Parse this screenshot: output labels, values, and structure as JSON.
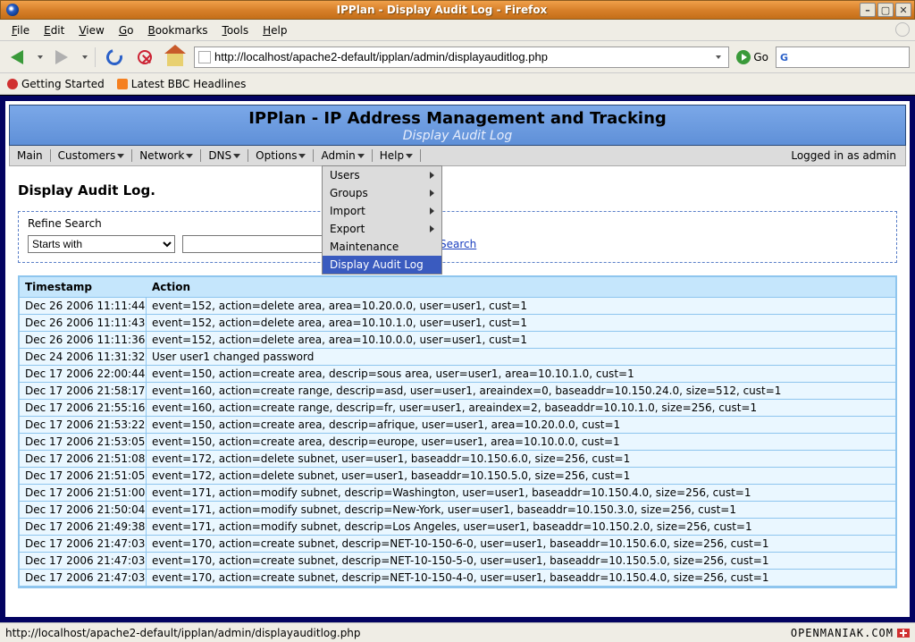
{
  "window": {
    "title": "IPPlan - Display Audit Log - Firefox"
  },
  "menubar": {
    "file": "File",
    "edit": "Edit",
    "view": "View",
    "go": "Go",
    "bookmarks": "Bookmarks",
    "tools": "Tools",
    "help": "Help"
  },
  "toolbar": {
    "url": "http://localhost/apache2-default/ipplan/admin/displayauditlog.php",
    "go_label": "Go"
  },
  "bookmarks": {
    "getting_started": "Getting Started",
    "bbc": "Latest BBC Headlines"
  },
  "app": {
    "title": "IPPlan - IP Address Management and Tracking",
    "subtitle": "Display Audit Log",
    "nav": {
      "main": "Main",
      "customers": "Customers",
      "network": "Network",
      "dns": "DNS",
      "options": "Options",
      "admin": "Admin",
      "help": "Help"
    },
    "login_status": "Logged in as admin",
    "admin_menu": {
      "users": "Users",
      "groups": "Groups",
      "import": "Import",
      "export": "Export",
      "maintenance": "Maintenance",
      "display_audit_log": "Display Audit Log"
    },
    "page_heading": "Display Audit Log.",
    "refine": {
      "legend": "Refine Search",
      "mode": "Starts with",
      "search_label": "Search"
    },
    "table": {
      "col_timestamp": "Timestamp",
      "col_action": "Action",
      "rows": [
        {
          "ts": "Dec 26 2006 11:11:44",
          "action": "event=152, action=delete area, area=10.20.0.0, user=user1, cust=1"
        },
        {
          "ts": "Dec 26 2006 11:11:43",
          "action": "event=152, action=delete area, area=10.10.1.0, user=user1, cust=1"
        },
        {
          "ts": "Dec 26 2006 11:11:36",
          "action": "event=152, action=delete area, area=10.10.0.0, user=user1, cust=1"
        },
        {
          "ts": "Dec 24 2006 11:31:32",
          "action": "User user1 changed password"
        },
        {
          "ts": "Dec 17 2006 22:00:44",
          "action": "event=150, action=create area, descrip=sous area, user=user1, area=10.10.1.0, cust=1"
        },
        {
          "ts": "Dec 17 2006 21:58:17",
          "action": "event=160, action=create range, descrip=asd, user=user1, areaindex=0, baseaddr=10.150.24.0, size=512, cust=1"
        },
        {
          "ts": "Dec 17 2006 21:55:16",
          "action": "event=160, action=create range, descrip=fr, user=user1, areaindex=2, baseaddr=10.10.1.0, size=256, cust=1"
        },
        {
          "ts": "Dec 17 2006 21:53:22",
          "action": "event=150, action=create area, descrip=afrique, user=user1, area=10.20.0.0, cust=1"
        },
        {
          "ts": "Dec 17 2006 21:53:05",
          "action": "event=150, action=create area, descrip=europe, user=user1, area=10.10.0.0, cust=1"
        },
        {
          "ts": "Dec 17 2006 21:51:08",
          "action": "event=172, action=delete subnet, user=user1, baseaddr=10.150.6.0, size=256, cust=1"
        },
        {
          "ts": "Dec 17 2006 21:51:05",
          "action": "event=172, action=delete subnet, user=user1, baseaddr=10.150.5.0, size=256, cust=1"
        },
        {
          "ts": "Dec 17 2006 21:51:00",
          "action": "event=171, action=modify subnet, descrip=Washington, user=user1, baseaddr=10.150.4.0, size=256, cust=1"
        },
        {
          "ts": "Dec 17 2006 21:50:04",
          "action": "event=171, action=modify subnet, descrip=New-York, user=user1, baseaddr=10.150.3.0, size=256, cust=1"
        },
        {
          "ts": "Dec 17 2006 21:49:38",
          "action": "event=171, action=modify subnet, descrip=Los Angeles, user=user1, baseaddr=10.150.2.0, size=256, cust=1"
        },
        {
          "ts": "Dec 17 2006 21:47:03",
          "action": "event=170, action=create subnet, descrip=NET-10-150-6-0, user=user1, baseaddr=10.150.6.0, size=256, cust=1"
        },
        {
          "ts": "Dec 17 2006 21:47:03",
          "action": "event=170, action=create subnet, descrip=NET-10-150-5-0, user=user1, baseaddr=10.150.5.0, size=256, cust=1"
        },
        {
          "ts": "Dec 17 2006 21:47:03",
          "action": "event=170, action=create subnet, descrip=NET-10-150-4-0, user=user1, baseaddr=10.150.4.0, size=256, cust=1"
        }
      ]
    }
  },
  "statusbar": {
    "text": "http://localhost/apache2-default/ipplan/admin/displayauditlog.php",
    "brand": "OPENMANIAK.COM"
  }
}
